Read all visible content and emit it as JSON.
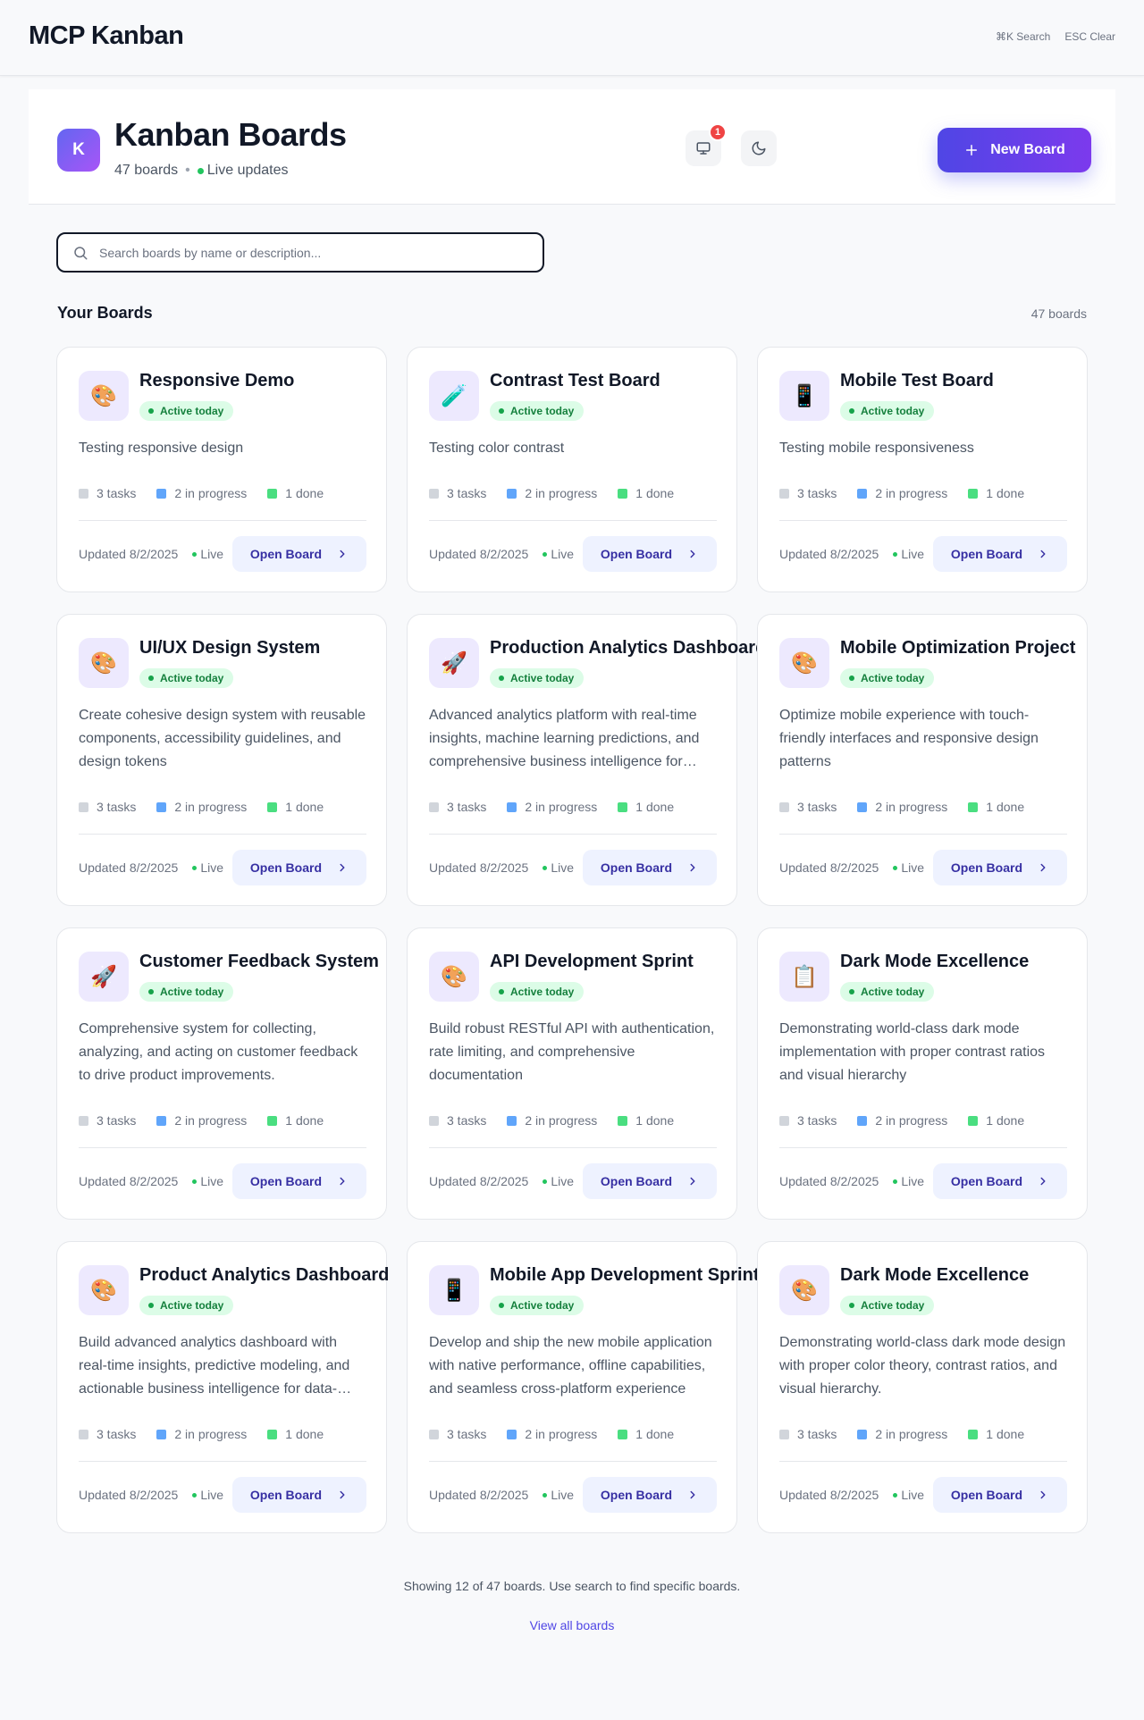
{
  "app": {
    "title": "MCP Kanban",
    "shortcuts": [
      "⌘K Search",
      "ESC Clear"
    ]
  },
  "header": {
    "logo_letter": "K",
    "title": "Kanban Boards",
    "board_count": "47 boards",
    "separator": "•",
    "live_label": "Live updates",
    "notification_count": "1",
    "new_board_label": "New Board",
    "icons": [
      "monitor-icon",
      "moon-icon",
      "plus-icon"
    ]
  },
  "search": {
    "placeholder": "Search boards by name or description..."
  },
  "section": {
    "title": "Your Boards",
    "count": "47 boards"
  },
  "boards": [
    {
      "icon": "🎨",
      "title": "Responsive Demo",
      "badge": "Active today",
      "description": "Testing responsive design",
      "tasks": "3 tasks",
      "in_progress": "2 in progress",
      "done": "1 done",
      "updated": "Updated 8/2/2025",
      "live": "Live",
      "open_label": "Open Board"
    },
    {
      "icon": "🧪",
      "title": "Contrast Test Board",
      "badge": "Active today",
      "description": "Testing color contrast",
      "tasks": "3 tasks",
      "in_progress": "2 in progress",
      "done": "1 done",
      "updated": "Updated 8/2/2025",
      "live": "Live",
      "open_label": "Open Board"
    },
    {
      "icon": "📱",
      "title": "Mobile Test Board",
      "badge": "Active today",
      "description": "Testing mobile responsiveness",
      "tasks": "3 tasks",
      "in_progress": "2 in progress",
      "done": "1 done",
      "updated": "Updated 8/2/2025",
      "live": "Live",
      "open_label": "Open Board"
    },
    {
      "icon": "🎨",
      "title": "UI/UX Design System",
      "badge": "Active today",
      "description": "Create cohesive design system with reusable components, accessibility guidelines, and design tokens",
      "tasks": "3 tasks",
      "in_progress": "2 in progress",
      "done": "1 done",
      "updated": "Updated 8/2/2025",
      "live": "Live",
      "open_label": "Open Board"
    },
    {
      "icon": "🚀",
      "title": "Production Analytics Dashboard",
      "badge": "Active today",
      "description": "Advanced analytics platform with real-time insights, machine learning predictions, and comprehensive business intelligence for decision makers",
      "tasks": "3 tasks",
      "in_progress": "2 in progress",
      "done": "1 done",
      "updated": "Updated 8/2/2025",
      "live": "Live",
      "open_label": "Open Board"
    },
    {
      "icon": "🎨",
      "title": "Mobile Optimization Project",
      "badge": "Active today",
      "description": "Optimize mobile experience with touch-friendly interfaces and responsive design patterns",
      "tasks": "3 tasks",
      "in_progress": "2 in progress",
      "done": "1 done",
      "updated": "Updated 8/2/2025",
      "live": "Live",
      "open_label": "Open Board"
    },
    {
      "icon": "🚀",
      "title": "Customer Feedback System",
      "badge": "Active today",
      "description": "Comprehensive system for collecting, analyzing, and acting on customer feedback to drive product improvements.",
      "tasks": "3 tasks",
      "in_progress": "2 in progress",
      "done": "1 done",
      "updated": "Updated 8/2/2025",
      "live": "Live",
      "open_label": "Open Board"
    },
    {
      "icon": "🎨",
      "title": "API Development Sprint",
      "badge": "Active today",
      "description": "Build robust RESTful API with authentication, rate limiting, and comprehensive documentation",
      "tasks": "3 tasks",
      "in_progress": "2 in progress",
      "done": "1 done",
      "updated": "Updated 8/2/2025",
      "live": "Live",
      "open_label": "Open Board"
    },
    {
      "icon": "📋",
      "title": "Dark Mode Excellence",
      "badge": "Active today",
      "description": "Demonstrating world-class dark mode implementation with proper contrast ratios and visual hierarchy",
      "tasks": "3 tasks",
      "in_progress": "2 in progress",
      "done": "1 done",
      "updated": "Updated 8/2/2025",
      "live": "Live",
      "open_label": "Open Board"
    },
    {
      "icon": "🎨",
      "title": "Product Analytics Dashboard",
      "badge": "Active today",
      "description": "Build advanced analytics dashboard with real-time insights, predictive modeling, and actionable business intelligence for data-driven decisions",
      "tasks": "3 tasks",
      "in_progress": "2 in progress",
      "done": "1 done",
      "updated": "Updated 8/2/2025",
      "live": "Live",
      "open_label": "Open Board"
    },
    {
      "icon": "📱",
      "title": "Mobile App Development Sprint",
      "badge": "Active today",
      "description": "Develop and ship the new mobile application with native performance, offline capabilities, and seamless cross-platform experience",
      "tasks": "3 tasks",
      "in_progress": "2 in progress",
      "done": "1 done",
      "updated": "Updated 8/2/2025",
      "live": "Live",
      "open_label": "Open Board"
    },
    {
      "icon": "🎨",
      "title": "Dark Mode Excellence",
      "badge": "Active today",
      "description": "Demonstrating world-class dark mode design with proper color theory, contrast ratios, and visual hierarchy.",
      "tasks": "3 tasks",
      "in_progress": "2 in progress",
      "done": "1 done",
      "updated": "Updated 8/2/2025",
      "live": "Live",
      "open_label": "Open Board"
    }
  ],
  "colors": {
    "accent": "#4f46e5",
    "tasks": "#d1d5db",
    "in_progress": "#60a5fa",
    "done": "#4ade80",
    "live": "#22c55e"
  },
  "footer": {
    "note": "Showing 12 of 47 boards. Use search to find specific boards.",
    "view_all": "View all boards"
  }
}
